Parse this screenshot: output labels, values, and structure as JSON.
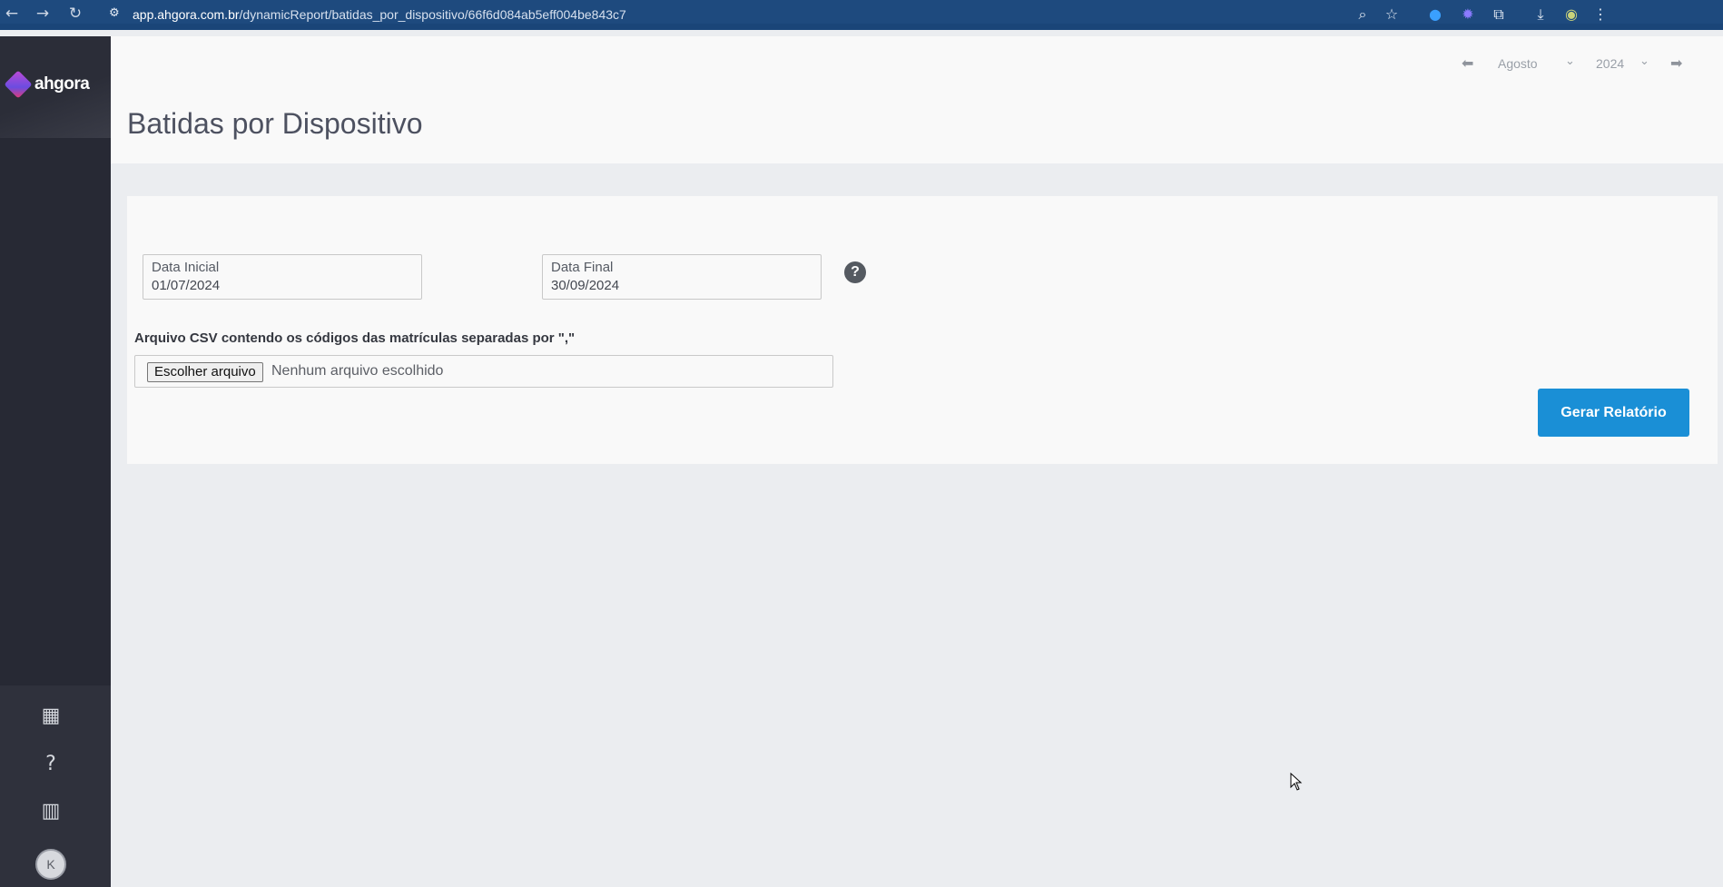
{
  "browser": {
    "url_host": "app.ahgora.com.br",
    "url_path": "/dynamicReport/batidas_por_dispositivo/66f6d084ab5eff004be843c7"
  },
  "sidebar": {
    "logo_text": "ahgora",
    "avatar_initial": "K",
    "icons": [
      "apps-grid-icon",
      "help-icon",
      "company-building-icon"
    ]
  },
  "header": {
    "title": "Batidas por Dispositivo",
    "month": "Agosto",
    "year": "2024"
  },
  "form": {
    "start_date_label": "Data Inicial",
    "start_date_value": "01/07/2024",
    "end_date_label": "Data Final",
    "end_date_value": "30/09/2024",
    "csv_label": "Arquivo CSV contendo os códigos das matrículas separadas por \",\"",
    "file_button_label": "Escolher arquivo",
    "file_status": "Nenhum arquivo escolhido",
    "submit_label": "Gerar Relatório"
  },
  "colors": {
    "accent": "#1a8fd6",
    "sidebar": "#272934",
    "browser_bar": "#1e4a7e"
  }
}
